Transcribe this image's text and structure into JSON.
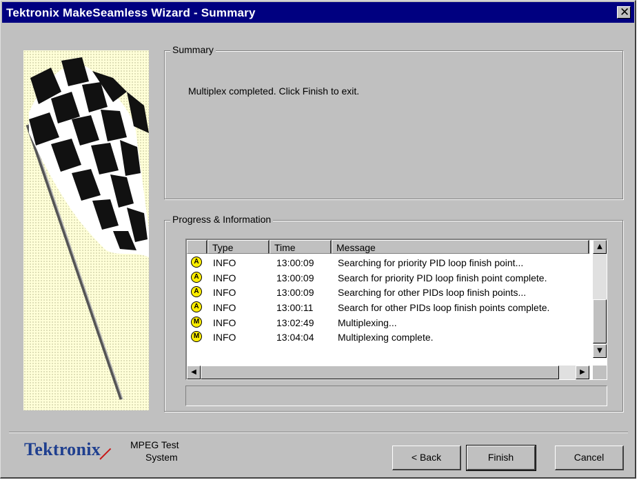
{
  "window": {
    "title": "Tektronix MakeSeamless Wizard - Summary",
    "close_glyph": "✕"
  },
  "summary": {
    "label": "Summary",
    "text": "Multiplex completed.  Click Finish to exit."
  },
  "progress": {
    "label": "Progress & Information",
    "columns": [
      "",
      "Type",
      "Time",
      "Message"
    ],
    "rows": [
      {
        "icon": "A",
        "type": "INFO",
        "time": "13:00:09",
        "message": "Searching for priority PID loop finish point..."
      },
      {
        "icon": "A",
        "type": "INFO",
        "time": "13:00:09",
        "message": "Search for priority PID loop finish point complete."
      },
      {
        "icon": "A",
        "type": "INFO",
        "time": "13:00:09",
        "message": "Searching for other PIDs loop finish points..."
      },
      {
        "icon": "A",
        "type": "INFO",
        "time": "13:00:11",
        "message": "Search for other PIDs loop finish points complete."
      },
      {
        "icon": "M",
        "type": "INFO",
        "time": "13:02:49",
        "message": "Multiplexing..."
      },
      {
        "icon": "M",
        "type": "INFO",
        "time": "13:04:04",
        "message": "Multiplexing complete."
      }
    ],
    "scroll": {
      "up": "▲",
      "down": "▼",
      "left": "◀",
      "right": "▶"
    }
  },
  "branding": {
    "logo": "Tektronix",
    "subtitle_line1": "MPEG Test",
    "subtitle_line2": "System"
  },
  "buttons": {
    "back": "< Back",
    "finish": "Finish",
    "cancel": "Cancel"
  },
  "colors": {
    "title_bar": "#000080",
    "dialog_bg": "#c0c0c0",
    "icon_yellow": "#ffee00",
    "logo_blue": "#1f3f8f"
  }
}
